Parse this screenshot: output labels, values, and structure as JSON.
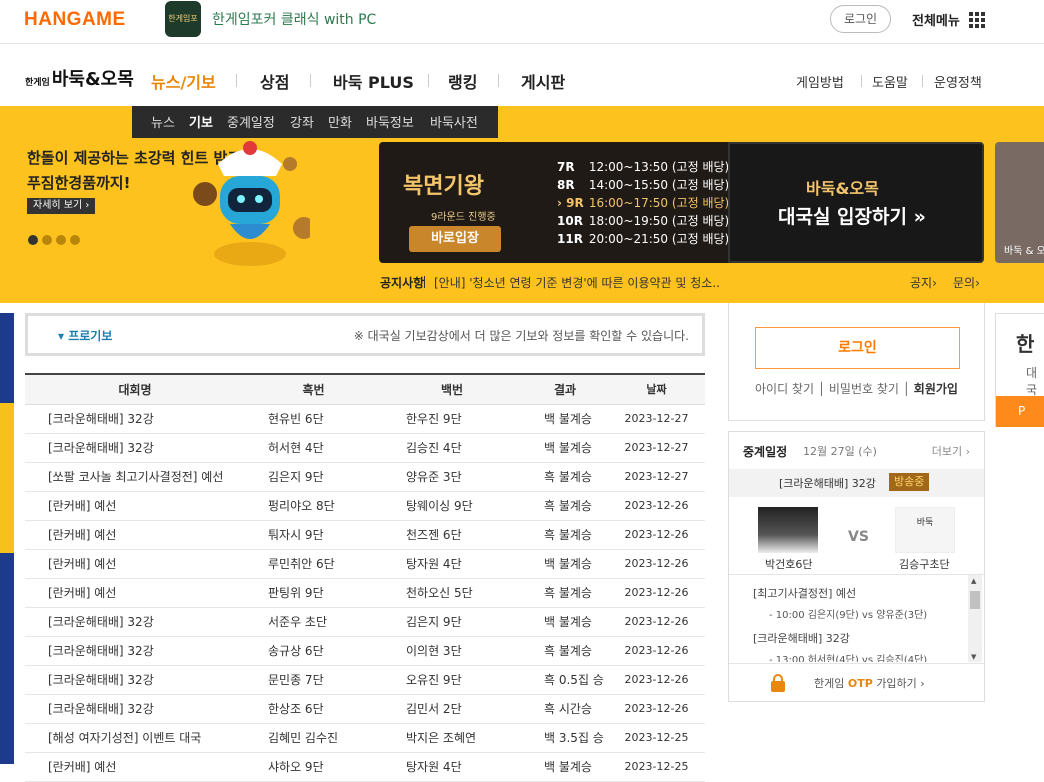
{
  "topbar": {
    "logo": "HANGAME",
    "poker_icon_label": "한게임포커",
    "poker_text": "한게임포커 클래식 with PC",
    "login": "로그인",
    "all_menu": "전체메뉴"
  },
  "gnb": {
    "logo_small": "한게임",
    "logo": "바둑&오목",
    "items": [
      "뉴스/기보",
      "상점",
      "바둑 PLUS",
      "랭킹",
      "게시판"
    ],
    "util": [
      "게임방법",
      "도움말",
      "운영정책"
    ]
  },
  "subnav": [
    "뉴스",
    "기보",
    "중계일정",
    "강좌",
    "만화",
    "바둑정보",
    "바둑사전"
  ],
  "promo": {
    "line1": "한돌이 제공하는 초강력 힌트 받고",
    "line2": "푸짐한경품까지!",
    "more": "자세히 보기 ›"
  },
  "event": {
    "title": "복면기왕",
    "sub": "9라운드 진행중",
    "button": "바로입장",
    "rounds": [
      {
        "r": "7R",
        "t": "12:00~13:50 (고정 배당)"
      },
      {
        "r": "8R",
        "t": "14:00~15:50 (고정 배당)"
      },
      {
        "r": "› 9R",
        "t": "16:00~17:50 (고정 배당)"
      },
      {
        "r": "10R",
        "t": "18:00~19:50 (고정 배당)"
      },
      {
        "r": "11R",
        "t": "20:00~21:50 (고정 배당)"
      }
    ],
    "current_round_color": "#f3c46a"
  },
  "enter": {
    "line1": "바둑&오목",
    "line2": "대국실 입장하기 »"
  },
  "side_banner": "바둑 & 오",
  "notice": {
    "label": "공지사항",
    "text": "[안내] '청소년 연령 기준 변경'에 따른 이용약관 및 청소..",
    "link1": "공지›",
    "link2": "문의›"
  },
  "filter": {
    "selected": "▾ 프로기보",
    "info": "※ 대국실 기보감상에서 더 많은 기보와 정보를 확인할 수 있습니다."
  },
  "table": {
    "headers": [
      "대회명",
      "흑번",
      "백번",
      "결과",
      "날짜"
    ],
    "rows": [
      [
        "[크라운해태배] 32강",
        "현유빈 6단",
        "한우진 9단",
        "백 불계승",
        "2023-12-27"
      ],
      [
        "[크라운해태배] 32강",
        "허서현 4단",
        "김승진 4단",
        "백 불계승",
        "2023-12-27"
      ],
      [
        "[쏘팔 코사놀 최고기사결정전] 예선",
        "김은지 9단",
        "양유준 3단",
        "흑 불계승",
        "2023-12-27"
      ],
      [
        "[란커배] 예선",
        "펑리야오 8단",
        "탕웨이싱 9단",
        "흑 불계승",
        "2023-12-26"
      ],
      [
        "[란커배] 예선",
        "퉈자시 9단",
        "천즈젠 6단",
        "흑 불계승",
        "2023-12-26"
      ],
      [
        "[란커배] 예선",
        "루민취안 6단",
        "탕자원 4단",
        "백 불계승",
        "2023-12-26"
      ],
      [
        "[란커배] 예선",
        "판팅위 9단",
        "천하오신 5단",
        "흑 불계승",
        "2023-12-26"
      ],
      [
        "[크라운해태배] 32강",
        "서준우 초단",
        "김은지 9단",
        "백 불계승",
        "2023-12-26"
      ],
      [
        "[크라운해태배] 32강",
        "송규상 6단",
        "이의현 3단",
        "흑 불계승",
        "2023-12-26"
      ],
      [
        "[크라운해태배] 32강",
        "문민종 7단",
        "오유진 9단",
        "흑 0.5집 승",
        "2023-12-26"
      ],
      [
        "[크라운해태배] 32강",
        "한상조 6단",
        "김민서 2단",
        "흑 시간승",
        "2023-12-26"
      ],
      [
        "[해성 여자기성전] 이벤트 대국",
        "김혜민 김수진",
        "박지은 조혜연",
        "백 3.5집 승",
        "2023-12-25"
      ],
      [
        "[란커배] 예선",
        "샤하오 9단",
        "탕자원 4단",
        "백 불계승",
        "2023-12-25"
      ]
    ]
  },
  "login_box": {
    "button": "로그인",
    "find_id": "아이디 찾기",
    "find_pw": "비밀번호 찾기",
    "join": "회원가입"
  },
  "live": {
    "title": "중계일정",
    "date": "12월 27일 (수)",
    "more": "더보기 ›",
    "match": "[크라운해태배] 32강",
    "badge": "방송중",
    "player1": "박건호6단",
    "player2": "김승구초단",
    "player2_img": "바둑",
    "vs": "VS",
    "list": [
      {
        "title": "[최고기사결정전] 예선",
        "sub": "- 10:00 김은지(9단) vs 양유준(3단)"
      },
      {
        "title": "[크라운해태배] 32강",
        "sub": "- 13:00 허서현(4단) vs 김승진(4단)"
      }
    ],
    "otp": "OTP",
    "otp_text_pre": "한게임",
    "otp_text_post": "가입하기 ›"
  },
  "right_edge": {
    "a": "한",
    "b": "대국",
    "c": "P"
  }
}
